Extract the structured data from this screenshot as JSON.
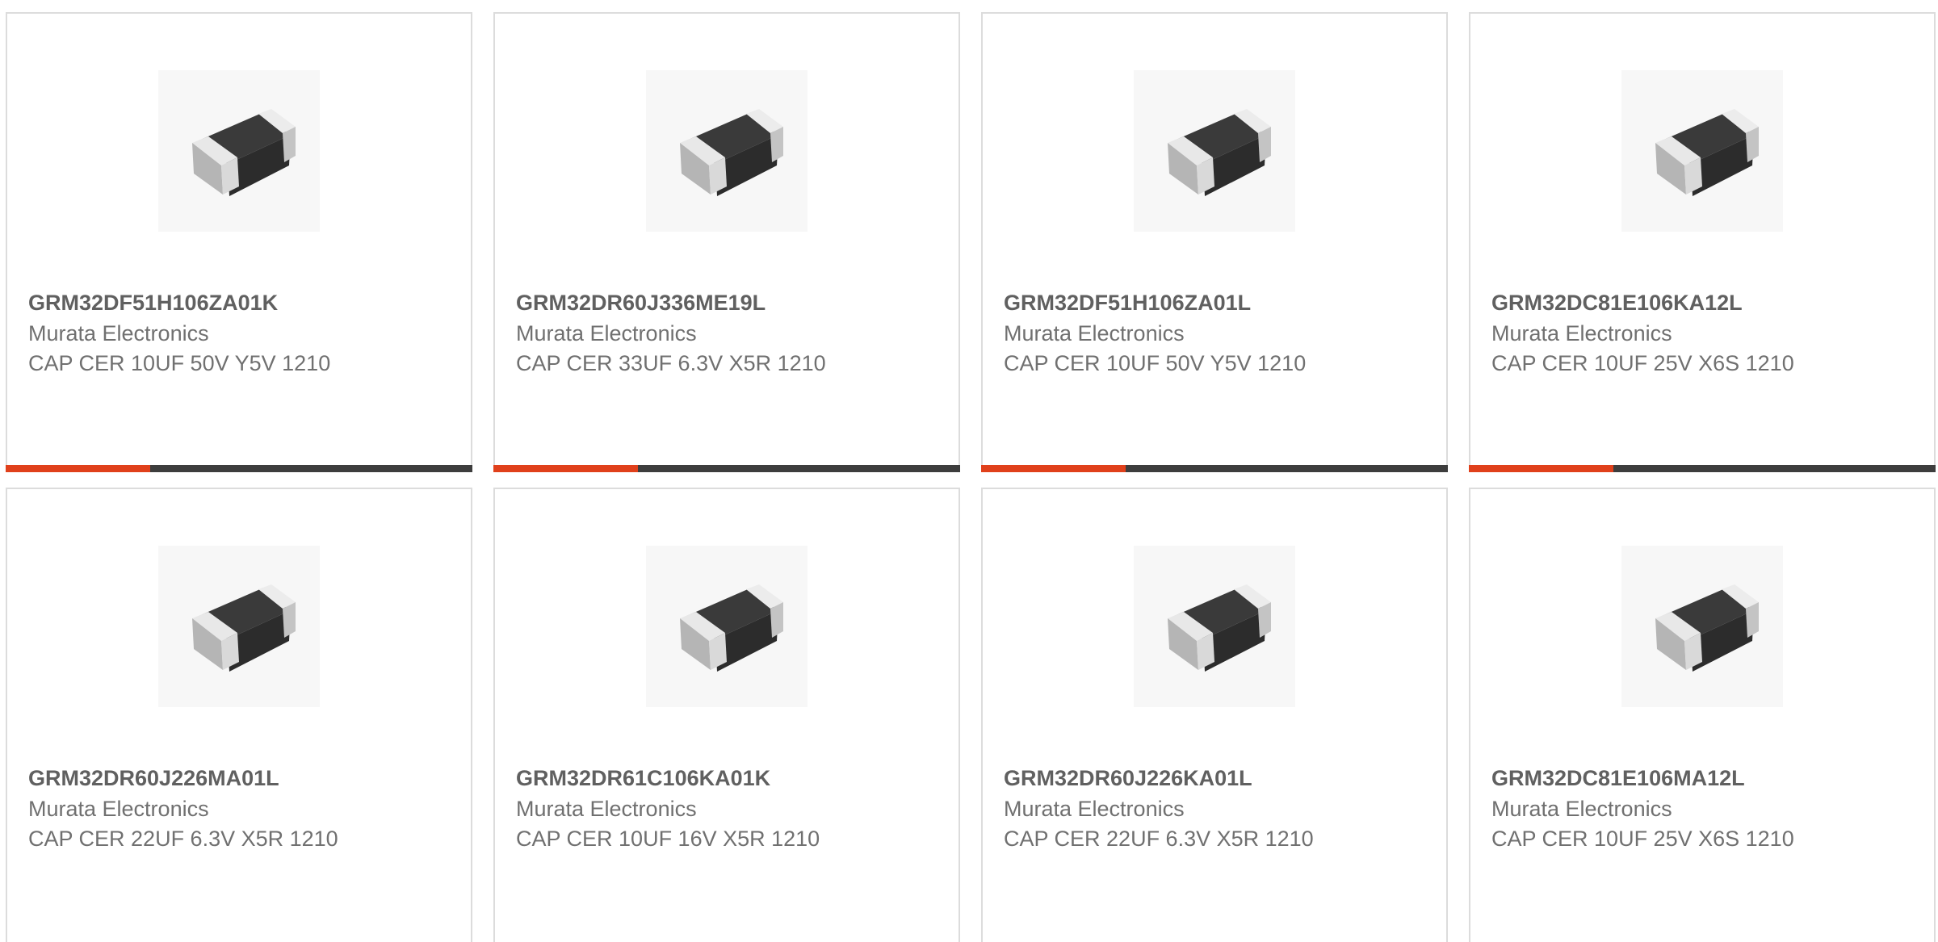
{
  "colors": {
    "accent": "#e0401b",
    "track": "#3d3d3d",
    "card_border": "#dcdcdc",
    "text": "#707070"
  },
  "products": [
    {
      "part_number": "GRM32DF51H106ZA01K",
      "manufacturer": "Murata Electronics",
      "description": "CAP CER 10UF 50V Y5V 1210",
      "image_icon": "ceramic-capacitor-chip-icon",
      "progress_fraction": 0.31
    },
    {
      "part_number": "GRM32DR60J336ME19L",
      "manufacturer": "Murata Electronics",
      "description": "CAP CER 33UF 6.3V X5R 1210",
      "image_icon": "ceramic-capacitor-chip-icon",
      "progress_fraction": 0.31
    },
    {
      "part_number": "GRM32DF51H106ZA01L",
      "manufacturer": "Murata Electronics",
      "description": "CAP CER 10UF 50V Y5V 1210",
      "image_icon": "ceramic-capacitor-chip-icon",
      "progress_fraction": 0.31
    },
    {
      "part_number": "GRM32DC81E106KA12L",
      "manufacturer": "Murata Electronics",
      "description": "CAP CER 10UF 25V X6S 1210",
      "image_icon": "ceramic-capacitor-chip-icon",
      "progress_fraction": 0.31
    },
    {
      "part_number": "GRM32DR60J226MA01L",
      "manufacturer": "Murata Electronics",
      "description": "CAP CER 22UF 6.3V X5R 1210",
      "image_icon": "ceramic-capacitor-chip-icon"
    },
    {
      "part_number": "GRM32DR61C106KA01K",
      "manufacturer": "Murata Electronics",
      "description": "CAP CER 10UF 16V X5R 1210",
      "image_icon": "ceramic-capacitor-chip-icon"
    },
    {
      "part_number": "GRM32DR60J226KA01L",
      "manufacturer": "Murata Electronics",
      "description": "CAP CER 22UF 6.3V X5R 1210",
      "image_icon": "ceramic-capacitor-chip-icon"
    },
    {
      "part_number": "GRM32DC81E106MA12L",
      "manufacturer": "Murata Electronics",
      "description": "CAP CER 10UF 25V X6S 1210",
      "image_icon": "ceramic-capacitor-chip-icon"
    }
  ]
}
